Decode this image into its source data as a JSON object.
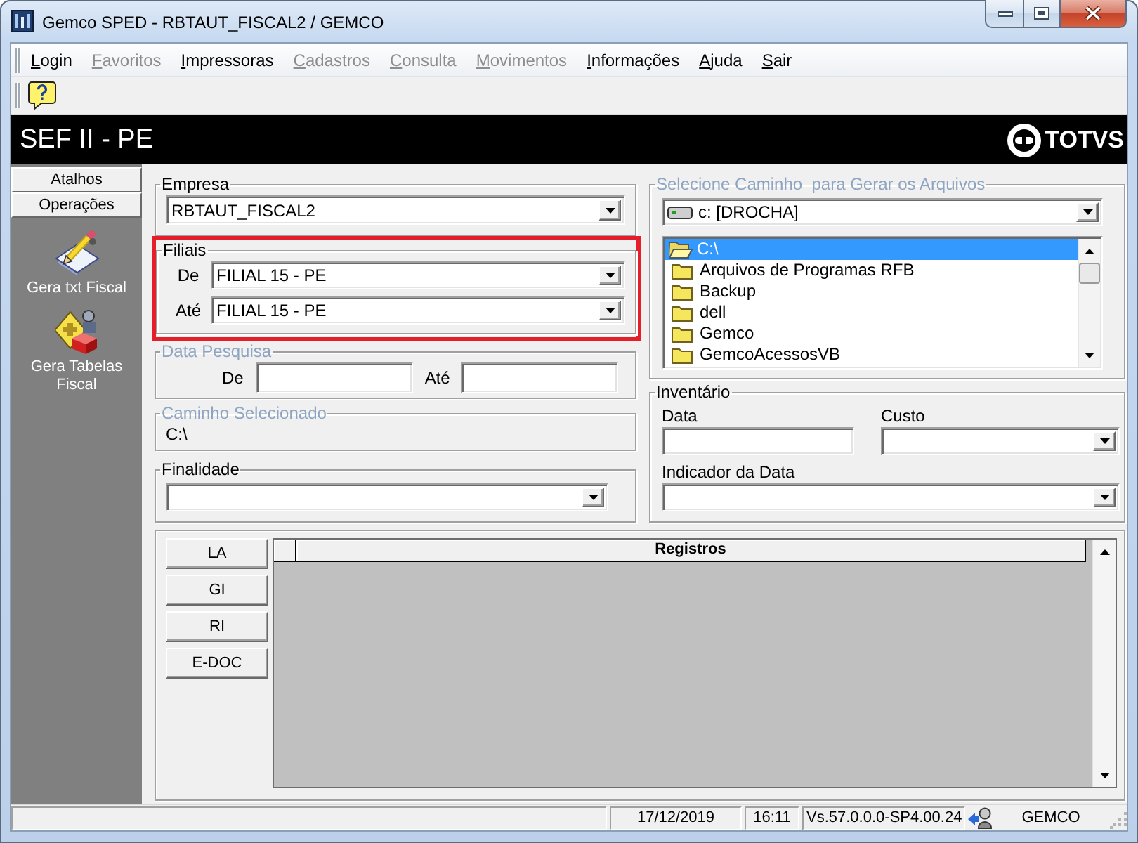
{
  "window": {
    "title": "Gemco SPED - RBTAUT_FISCAL2 / GEMCO"
  },
  "menu": [
    {
      "label": "Login",
      "disabled": false
    },
    {
      "label": "Favoritos",
      "disabled": true
    },
    {
      "label": "Impressoras",
      "disabled": false
    },
    {
      "label": "Cadastros",
      "disabled": true
    },
    {
      "label": "Consulta",
      "disabled": true
    },
    {
      "label": "Movimentos",
      "disabled": true
    },
    {
      "label": "Informações",
      "disabled": false
    },
    {
      "label": "Ajuda",
      "disabled": false
    },
    {
      "label": "Sair",
      "disabled": false
    }
  ],
  "header": {
    "title": "SEF II - PE",
    "logo": "TOTVS"
  },
  "sidebar": {
    "sections": [
      "Atalhos",
      "Operações"
    ],
    "items": [
      {
        "label": "Gera txt Fiscal"
      },
      {
        "label": "Gera Tabelas Fiscal"
      }
    ]
  },
  "empresa": {
    "label": "Empresa",
    "disabled": false,
    "value": "RBTAUT_FISCAL2"
  },
  "filiais": {
    "label": "Filiais",
    "disabled": false,
    "highlighted": true,
    "fields": [
      {
        "label": "De",
        "value": "FILIAL 15 - PE"
      },
      {
        "label": "Até",
        "value": "FILIAL 15 - PE"
      }
    ]
  },
  "data_pesquisa": {
    "label": "Data Pesquisa",
    "disabled": true,
    "fields": [
      {
        "label": "De"
      },
      {
        "label": "Até"
      }
    ]
  },
  "caminho_selecionado": {
    "label": "Caminho Selecionado",
    "disabled": true,
    "value": "C:\\"
  },
  "finalidade": {
    "label": "Finalidade",
    "disabled": false
  },
  "selecione_caminho": {
    "label": "Selecione Caminho  para Gerar os Arquivos",
    "disabled": true,
    "drive": "c: [DROCHA]",
    "folders": [
      {
        "name": "C:\\",
        "selected": true,
        "expanded": true,
        "children": [
          {
            "name": "Arquivos de Programas RFB",
            "selected": false,
            "expanded": false
          },
          {
            "name": "Backup",
            "selected": false,
            "expanded": false
          },
          {
            "name": "dell",
            "selected": false,
            "expanded": false
          },
          {
            "name": "Gemco",
            "selected": false,
            "expanded": false
          },
          {
            "name": "GemcoAcessosVB",
            "selected": false,
            "expanded": false
          }
        ]
      }
    ]
  },
  "inventario": {
    "label": "Inventário",
    "disabled": false,
    "data": {
      "label": "Data"
    },
    "custo": {
      "label": "Custo"
    },
    "indicador": {
      "label": "Indicador da Data"
    }
  },
  "bottom_panel": {
    "buttons": [
      "LA",
      "GI",
      "RI",
      "E-DOC"
    ],
    "table": {
      "columns": [
        "Registros"
      ]
    }
  },
  "status_bar": {
    "date": "17/12/2019",
    "time": "16:11",
    "version": "Vs.57.0.0.0-SP4.00.24",
    "user": "GEMCO"
  }
}
